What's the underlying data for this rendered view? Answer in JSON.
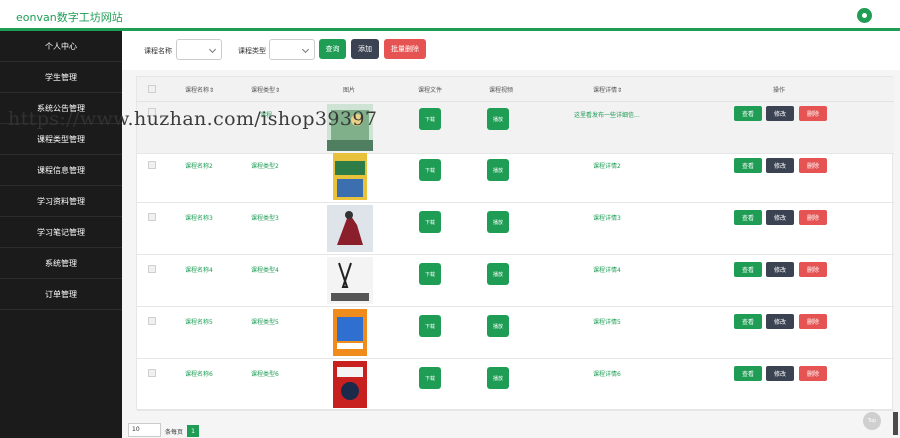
{
  "app": {
    "title": "eonvan数字工坊网站"
  },
  "sidebar": {
    "items": [
      {
        "label": "个人中心"
      },
      {
        "label": "学生管理"
      },
      {
        "label": "系统公告管理"
      },
      {
        "label": "课程类型管理"
      },
      {
        "label": "课程信息管理"
      },
      {
        "label": "学习资料管理"
      },
      {
        "label": "学习笔记管理"
      },
      {
        "label": "系统管理"
      },
      {
        "label": "订单管理"
      }
    ]
  },
  "search": {
    "course_name_label": "课程名称",
    "course_type_label": "课程类型",
    "query_button": "查询",
    "add_button": "添加",
    "batch_delete_button": "批量删除"
  },
  "table": {
    "headers": [
      "课程名称⇕",
      "课程类型⇕",
      "图片",
      "课程文件",
      "课程视频",
      "课程详情⇕",
      "操作"
    ],
    "download_label": "下载",
    "play_label": "播放",
    "view_label": "查看",
    "edit_label": "修改",
    "delete_label": "删除",
    "rows": [
      {
        "name": "",
        "type": "课程",
        "detail": "这里看发布一些详细信..."
      },
      {
        "name": "课程名称2",
        "type": "课程类型2",
        "detail": "课程详情2"
      },
      {
        "name": "课程名称3",
        "type": "课程类型3",
        "detail": "课程详情3"
      },
      {
        "name": "课程名称4",
        "type": "课程类型4",
        "detail": "课程详情4"
      },
      {
        "name": "课程名称5",
        "type": "课程类型5",
        "detail": "课程详情5"
      },
      {
        "name": "课程名称6",
        "type": "课程类型6",
        "detail": "课程详情6"
      }
    ]
  },
  "pagination": {
    "page_size": "10",
    "per_page_label": "条每页",
    "current_page": "1"
  },
  "back_to_top": {
    "label": "Top"
  },
  "watermark": {
    "text": "https://www.huzhan.com/ishop39397"
  },
  "colors": {
    "accent": "#1f9d55",
    "danger": "#e55353",
    "dark": "#3b4252"
  }
}
